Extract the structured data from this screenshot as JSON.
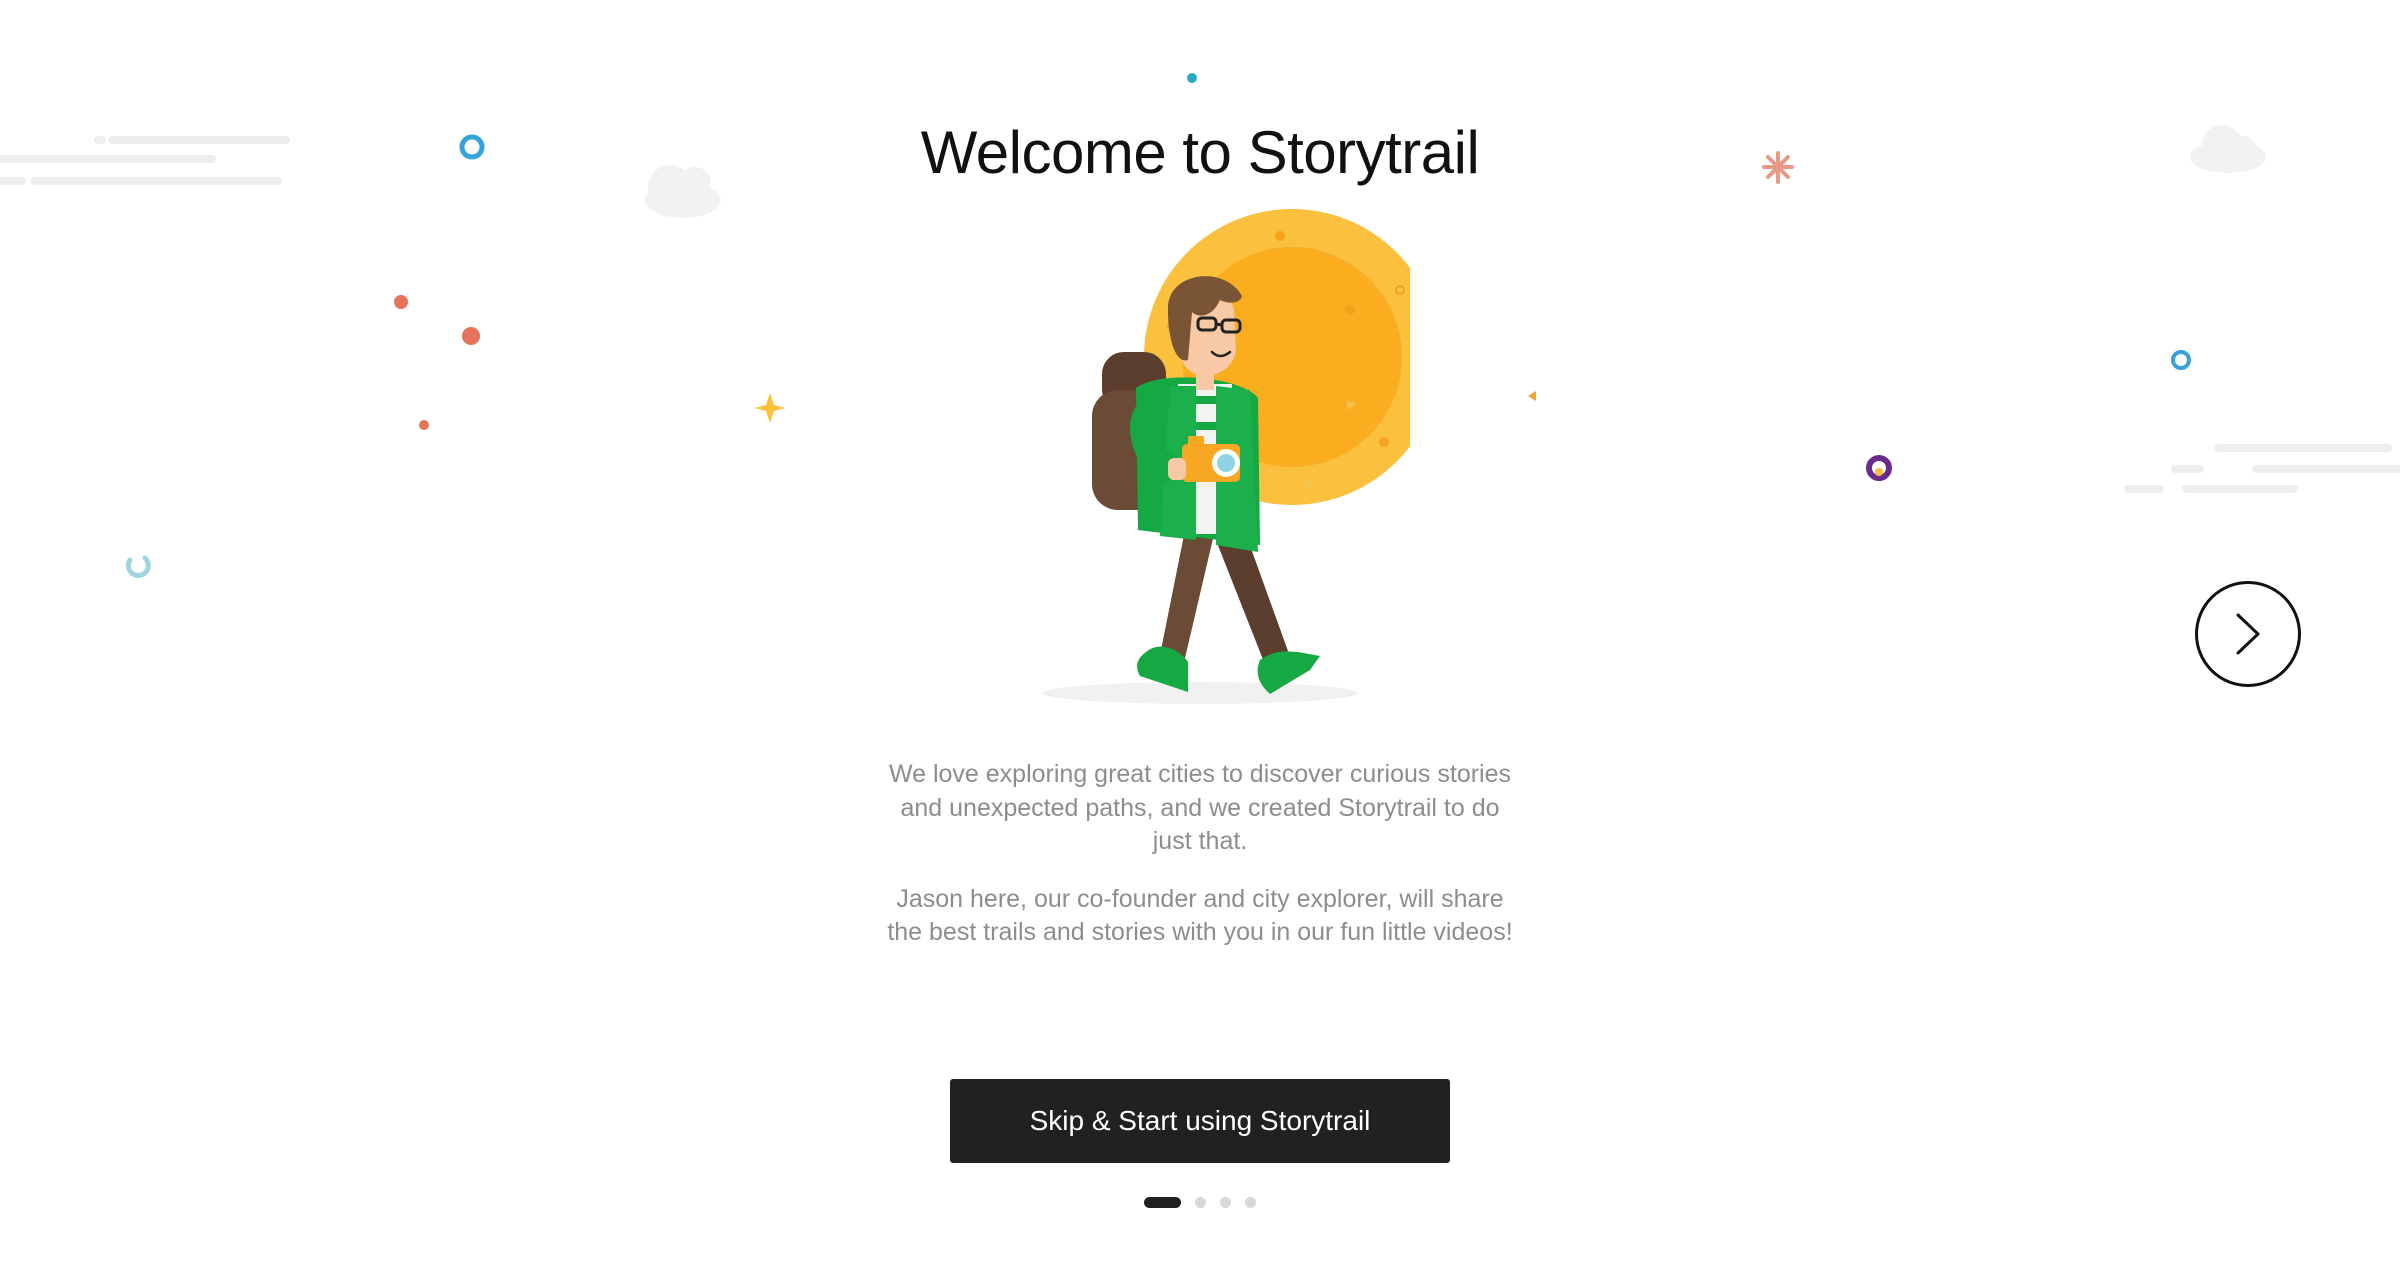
{
  "page": {
    "title": "Welcome to Storytrail",
    "paragraphs": [
      "We love exploring great cities to discover curious stories and unexpected paths, and we created Storytrail to do just that.",
      "Jason here, our co-founder and city explorer, will share the best trails and stories with you in our fun little videos!"
    ]
  },
  "actions": {
    "skip_label": "Skip & Start using Storytrail",
    "next_icon": "chevron-right-icon"
  },
  "pagination": {
    "total": 4,
    "current": 1
  },
  "colors": {
    "text": "#111111",
    "body_text": "#8d8d8d",
    "button_bg": "#222021",
    "sun": "#fcc03f",
    "sun_inner": "#f9ad1f",
    "jacket": "#16a843",
    "coral": "#e7735a",
    "teal": "#2aa9bd",
    "blue": "#36a2d8",
    "purple": "#6a2b8c"
  }
}
